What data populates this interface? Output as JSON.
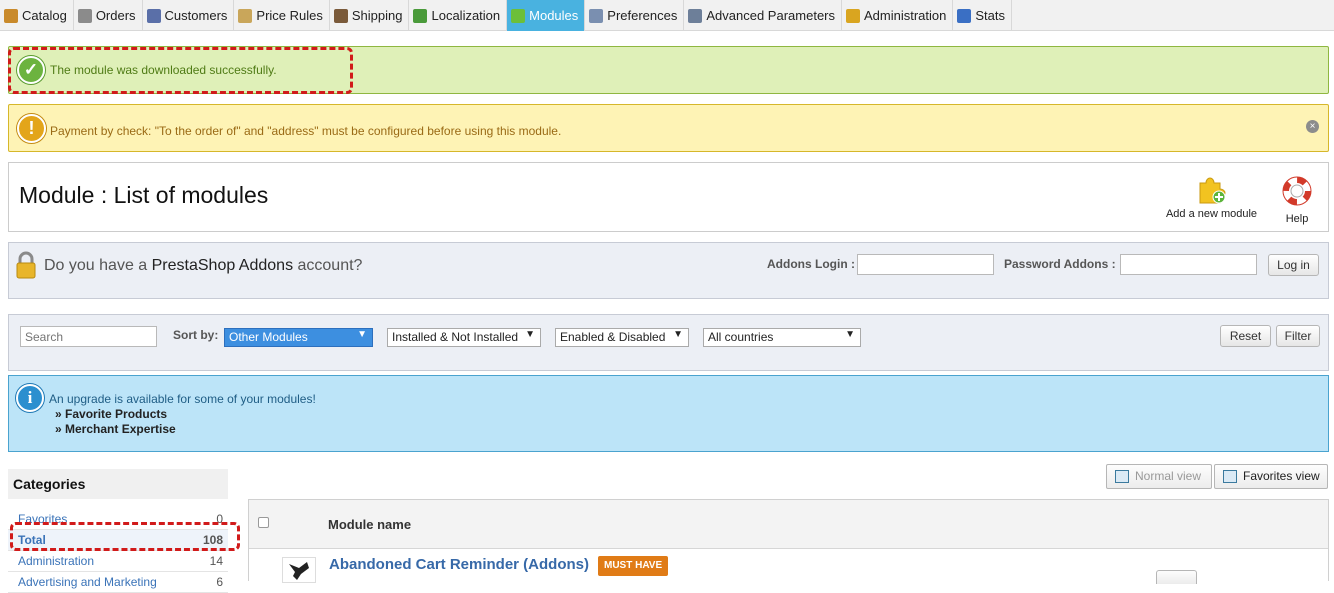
{
  "nav": {
    "tabs": [
      {
        "label": "Catalog",
        "icon": "catalog-icon",
        "color": "#c98a2b"
      },
      {
        "label": "Orders",
        "icon": "orders-icon",
        "color": "#8b8b8b"
      },
      {
        "label": "Customers",
        "icon": "customers-icon",
        "color": "#5a6fa8"
      },
      {
        "label": "Price Rules",
        "icon": "price-rules-icon",
        "color": "#c9a65a"
      },
      {
        "label": "Shipping",
        "icon": "shipping-icon",
        "color": "#7a5a3a"
      },
      {
        "label": "Localization",
        "icon": "localization-icon",
        "color": "#4a9a3a"
      },
      {
        "label": "Modules",
        "icon": "modules-icon",
        "color": "#6cbf3a"
      },
      {
        "label": "Preferences",
        "icon": "preferences-icon",
        "color": "#7a8fb0"
      },
      {
        "label": "Advanced Parameters",
        "icon": "advanced-parameters-icon",
        "color": "#6d7f99"
      },
      {
        "label": "Administration",
        "icon": "administration-icon",
        "color": "#d9a520"
      },
      {
        "label": "Stats",
        "icon": "stats-icon",
        "color": "#3a6fc4"
      }
    ],
    "active_index": 6
  },
  "alerts": {
    "success": "The module was downloaded successfully.",
    "warning": "Payment by check: \"To the order of\" and \"address\" must be configured before using this module."
  },
  "page": {
    "title": "Module : List of modules",
    "add_module_label": "Add a new module",
    "help_label": "Help"
  },
  "addons": {
    "question_pre": "Do you have a ",
    "question_brand": "PrestaShop Addons",
    "question_post": " account?",
    "login_label": "Addons Login :",
    "password_label": "Password Addons :",
    "login_button": "Log in"
  },
  "filter": {
    "search_placeholder": "Search",
    "sort_by_label": "Sort by:",
    "sort_value": "Other Modules",
    "install_value": "Installed & Not Installed",
    "enabled_value": "Enabled & Disabled",
    "country_value": "All countries",
    "reset_button": "Reset",
    "filter_button": "Filter"
  },
  "upgrade": {
    "message": "An upgrade is available for some of your modules!",
    "modules": [
      "Favorite Products",
      "Merchant Expertise"
    ]
  },
  "categories": {
    "title": "Categories",
    "items": [
      {
        "name": "Favorites",
        "count": "0"
      },
      {
        "name": "Total",
        "count": "108"
      },
      {
        "name": "Administration",
        "count": "14"
      },
      {
        "name": "Advertising and Marketing",
        "count": "6"
      }
    ]
  },
  "views": {
    "normal": "Normal view",
    "favorites": "Favorites view"
  },
  "table": {
    "header": "Module name",
    "first_module": "Abandoned Cart Reminder (Addons)",
    "badge": "MUST HAVE"
  },
  "colors": {
    "accent": "#49b2e0",
    "highlight": "#d11a1a",
    "success_bg": "#dff0b8",
    "warning_bg": "#fef3b5",
    "info_bg": "#bce4f8"
  }
}
